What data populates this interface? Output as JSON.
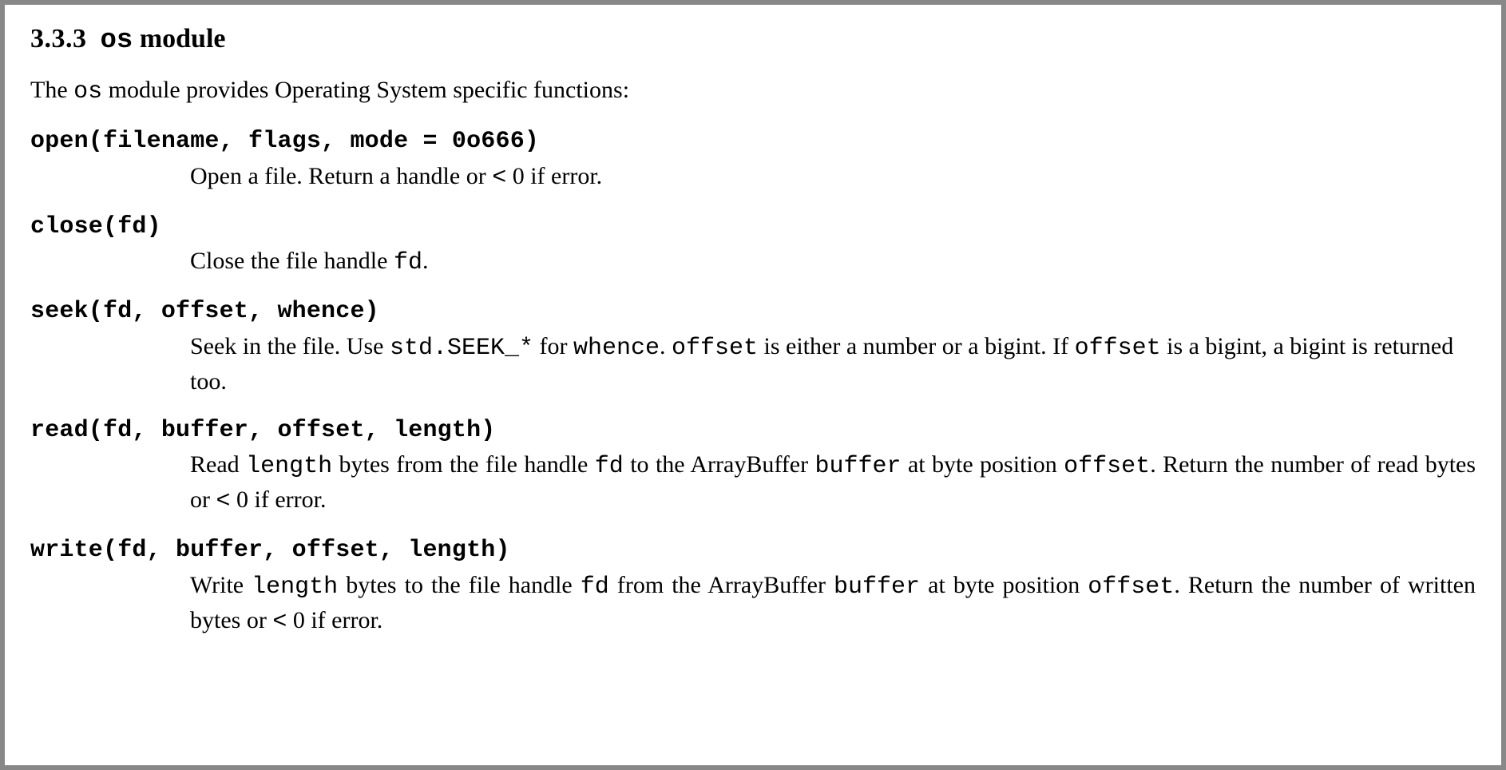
{
  "heading": {
    "number": "3.3.3",
    "code": "os",
    "word": "module"
  },
  "intro": {
    "pre": "The ",
    "code": "os",
    "post": " module provides Operating System specific functions:"
  },
  "entries": [
    {
      "sig": "open(filename, flags, mode = 0o666)",
      "desc_parts": [
        {
          "t": "text",
          "v": "Open a file.  Return a handle or "
        },
        {
          "t": "tt",
          "v": "<"
        },
        {
          "t": "text",
          "v": " 0 if error."
        }
      ],
      "justify": false
    },
    {
      "sig": "close(fd)",
      "desc_parts": [
        {
          "t": "text",
          "v": "Close the file handle "
        },
        {
          "t": "tt",
          "v": "fd"
        },
        {
          "t": "text",
          "v": "."
        }
      ],
      "justify": false
    },
    {
      "sig": "seek(fd, offset, whence)",
      "desc_parts": [
        {
          "t": "text",
          "v": "Seek in the file.  Use "
        },
        {
          "t": "tt",
          "v": "std.SEEK_*"
        },
        {
          "t": "text",
          "v": " for "
        },
        {
          "t": "tt",
          "v": "whence"
        },
        {
          "t": "text",
          "v": ".  "
        },
        {
          "t": "tt",
          "v": "offset"
        },
        {
          "t": "text",
          "v": " is either a number or a bigint. If "
        },
        {
          "t": "tt",
          "v": "offset"
        },
        {
          "t": "text",
          "v": " is a bigint, a bigint is returned too."
        }
      ],
      "justify": false
    },
    {
      "sig": "read(fd, buffer, offset, length)",
      "desc_parts": [
        {
          "t": "text",
          "v": "Read "
        },
        {
          "t": "tt",
          "v": "length"
        },
        {
          "t": "text",
          "v": " bytes from the file handle "
        },
        {
          "t": "tt",
          "v": "fd"
        },
        {
          "t": "text",
          "v": " to the ArrayBuffer "
        },
        {
          "t": "tt",
          "v": "buffer"
        },
        {
          "t": "text",
          "v": " at byte position "
        },
        {
          "t": "tt",
          "v": "offset"
        },
        {
          "t": "text",
          "v": ".  Return the number of read bytes or "
        },
        {
          "t": "tt",
          "v": "<"
        },
        {
          "t": "text",
          "v": " 0 if error."
        }
      ],
      "justify": true
    },
    {
      "sig": "write(fd, buffer, offset, length)",
      "desc_parts": [
        {
          "t": "text",
          "v": "Write "
        },
        {
          "t": "tt",
          "v": "length"
        },
        {
          "t": "text",
          "v": " bytes to the file handle "
        },
        {
          "t": "tt",
          "v": "fd"
        },
        {
          "t": "text",
          "v": " from the ArrayBuffer "
        },
        {
          "t": "tt",
          "v": "buffer"
        },
        {
          "t": "text",
          "v": " at byte position "
        },
        {
          "t": "tt",
          "v": "offset"
        },
        {
          "t": "text",
          "v": ".  Return the number of written bytes or "
        },
        {
          "t": "tt",
          "v": "<"
        },
        {
          "t": "text",
          "v": " 0 if error."
        }
      ],
      "justify": true
    }
  ]
}
